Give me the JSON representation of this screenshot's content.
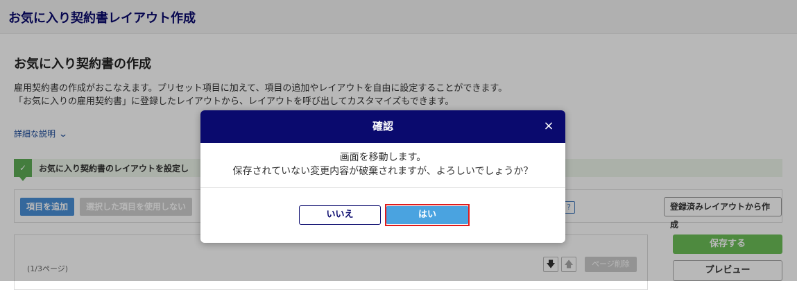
{
  "header": {
    "title": "お気に入り契約書レイアウト作成"
  },
  "page": {
    "title": "お気に入り契約書の作成",
    "desc_line1": "雇用契約書の作成がおこなえます。プリセット項目に加えて、項目の追加やレイアウトを自由に設定することができます。",
    "desc_line2": "「お気に入りの雇用契約書」に登録したレイアウトから、レイアウトを呼び出してカスタマイズもできます。",
    "detail_link": "詳細な説明",
    "info_text": "お気に入り契約書のレイアウトを設定し"
  },
  "toolbar": {
    "add_item": "項目を追加",
    "disable_item": "選択した項目を使用しない",
    "help": "?",
    "from_registered": "登録済みレイアウトから作成"
  },
  "panel": {
    "page_indicator": "(1/3ページ)",
    "page_delete": "ページ削除"
  },
  "side": {
    "save": "保存する",
    "preview": "プレビュー"
  },
  "modal": {
    "title": "確認",
    "close": "×",
    "message_line1": "画面を移動します。",
    "message_line2": "保存されていない変更内容が破棄されますが、よろしいでしょうか？",
    "no_label": "いいえ",
    "yes_label": "はい"
  },
  "icons": {
    "chevron": "chevron-down-icon",
    "check": "check-icon",
    "arrow_down": "arrow-down-icon",
    "arrow_up": "arrow-up-icon"
  },
  "colors": {
    "navy": "#0a0a6e",
    "primary_blue": "#4aa3e0",
    "save_green": "#6cbf58",
    "highlight_red": "#e01b1b"
  }
}
